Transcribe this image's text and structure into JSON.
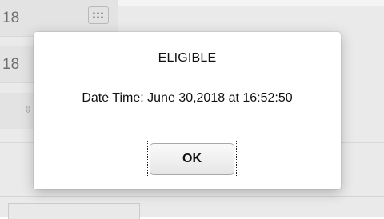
{
  "background": {
    "field_1_value": "18",
    "field_2_value": "18",
    "stepper_glyph": "⇳",
    "calendar_icon": "calendar-icon"
  },
  "dialog": {
    "title": "ELIGIBLE",
    "message": "Date Time: June 30,2018 at 16:52:50",
    "ok_label": "OK"
  }
}
